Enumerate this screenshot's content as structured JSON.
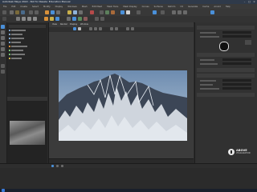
{
  "window": {
    "title": "Autodesk Maya 2022 - Not for Resale: Education Manual"
  },
  "menu": [
    "File",
    "Edit",
    "Create",
    "Select",
    "Modify",
    "Display",
    "Windows",
    "Mesh",
    "Edit Mesh",
    "Mesh Tools",
    "Mesh Display",
    "Curves",
    "Surfaces",
    "Deform",
    "UV",
    "Generate",
    "Cache",
    "Arnold",
    "Help"
  ],
  "viewport": {
    "menus": [
      "View",
      "Render",
      "Display",
      "Window"
    ]
  },
  "logo": {
    "line1": "ABOVE",
    "line2": "VISUALIZATION"
  },
  "colors": {
    "sky_top": "#6d8cb0",
    "sky_bottom": "#b9c8d8",
    "rock": "#3c4656",
    "snow": "#e9eef4",
    "accent_icon_blue": "#4a90d9",
    "accent_icon_orange": "#d9913a"
  }
}
